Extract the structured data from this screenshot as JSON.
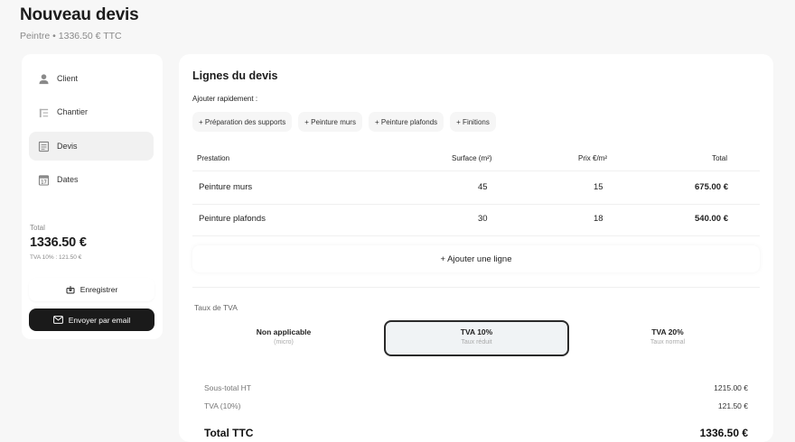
{
  "header": {
    "title": "Nouveau devis",
    "subtitle": "Peintre • 1336.50 € TTC"
  },
  "sidebar": {
    "items": [
      {
        "label": "Client",
        "icon": "user-icon",
        "active": false
      },
      {
        "label": "Chantier",
        "icon": "building-icon",
        "active": false
      },
      {
        "label": "Devis",
        "icon": "document-icon",
        "active": true
      },
      {
        "label": "Dates",
        "icon": "calendar-icon",
        "active": false
      }
    ],
    "total_label": "Total",
    "total_amount": "1336.50 €",
    "tva_line": "TVA 10% : 121.50 €",
    "save_label": "Enregistrer",
    "email_label": "Envoyer par email"
  },
  "main": {
    "title": "Lignes du devis",
    "quick_add_label": "Ajouter rapidement :",
    "chips": [
      "+ Préparation des supports",
      "+ Peinture murs",
      "+ Peinture plafonds",
      "+ Finitions"
    ],
    "table": {
      "headers": [
        "Prestation",
        "Surface (m²)",
        "Prix €/m²",
        "Total"
      ],
      "rows": [
        [
          "Peinture murs",
          "45",
          "15",
          "675.00 €"
        ],
        [
          "Peinture plafonds",
          "30",
          "18",
          "540.00 €"
        ]
      ]
    },
    "add_line_label": "+ Ajouter une ligne",
    "tva": {
      "label": "Taux de TVA",
      "options": [
        {
          "name": "Non applicable",
          "sub": "(micro)",
          "selected": false
        },
        {
          "name": "TVA 10%",
          "sub": "Taux réduit",
          "selected": true
        },
        {
          "name": "TVA 20%",
          "sub": "Taux normal",
          "selected": false
        }
      ]
    },
    "summary": {
      "subtotal_label": "Sous-total HT",
      "subtotal_value": "1215.00 €",
      "tva_label": "TVA (10%)",
      "tva_value": "121.50 €",
      "total_label": "Total TTC",
      "total_value": "1336.50 €"
    }
  },
  "colors": {
    "background": "#f7f7f7",
    "card": "#ffffff",
    "primary_button": "#1a1a1a",
    "selected_border": "#2a2a2a"
  }
}
